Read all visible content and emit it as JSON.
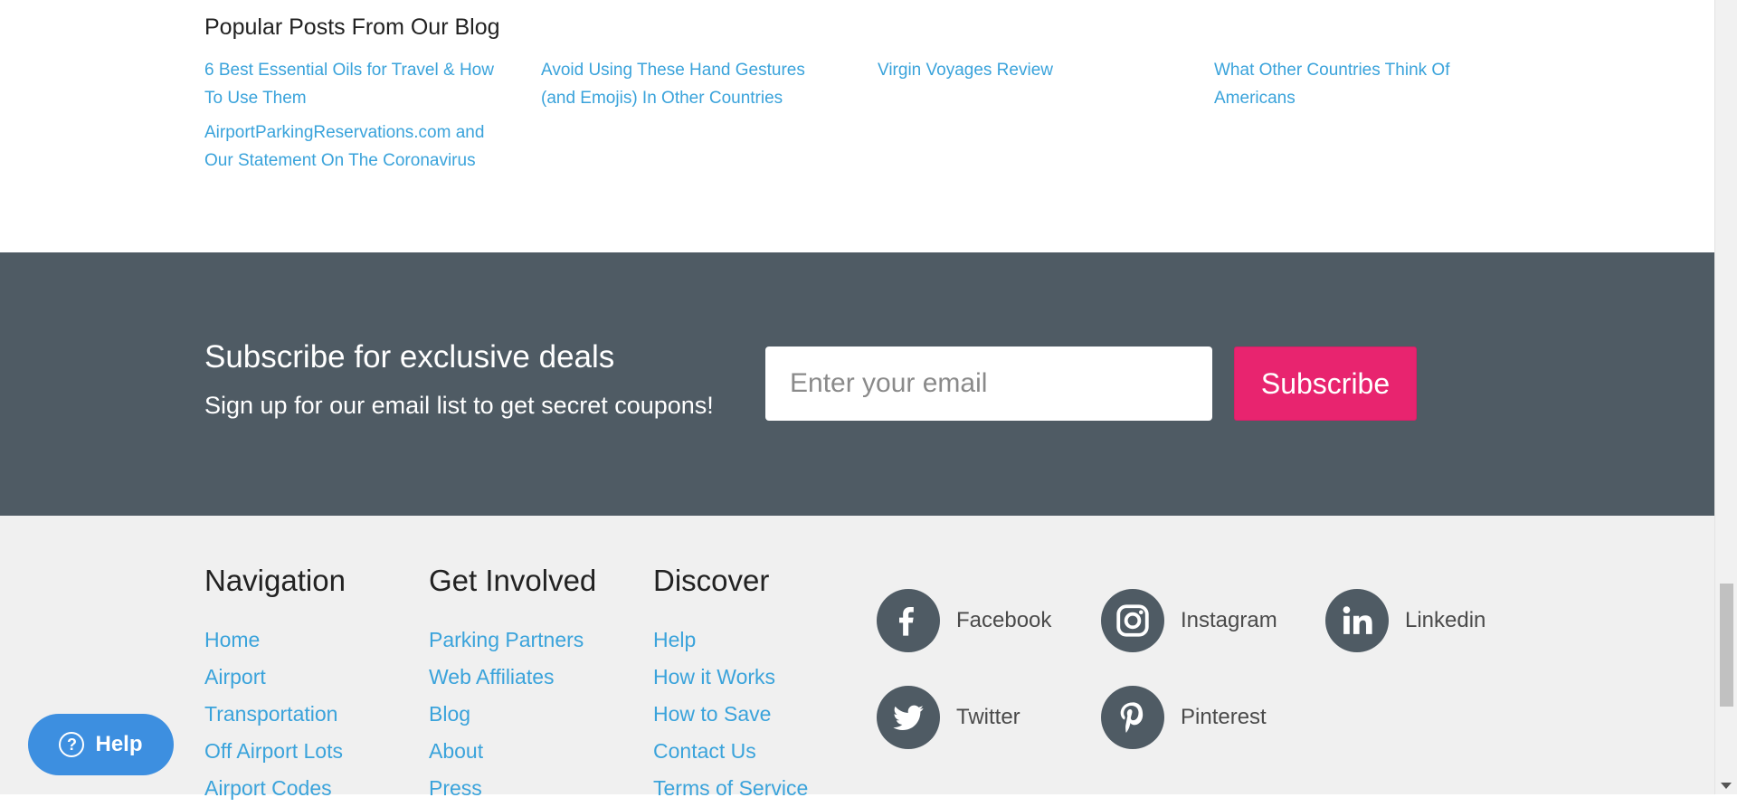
{
  "blog": {
    "title": "Popular Posts From Our Blog",
    "posts": [
      "6 Best Essential Oils for Travel & How To Use Them",
      "Avoid Using These Hand Gestures (and Emojis) In Other Countries",
      "Virgin Voyages Review",
      "What Other Countries Think Of Americans",
      "AirportParkingReservations.com and Our Statement On The Coronavirus"
    ]
  },
  "subscribe": {
    "heading": "Subscribe for exclusive deals",
    "text": "Sign up for our email list to get secret coupons!",
    "email_placeholder": "Enter your email",
    "button_label": "Subscribe"
  },
  "footer": {
    "navigation": {
      "heading": "Navigation",
      "items": [
        "Home",
        "Airport",
        "Transportation",
        "Off Airport Lots",
        "Airport Codes"
      ]
    },
    "get_involved": {
      "heading": "Get Involved",
      "items": [
        "Parking Partners",
        "Web Affiliates",
        "Blog",
        "About",
        "Press"
      ]
    },
    "discover": {
      "heading": "Discover",
      "items": [
        "Help",
        "How it Works",
        "How to Save",
        "Contact Us",
        "Terms of Service"
      ]
    },
    "social": [
      {
        "label": "Facebook",
        "icon": "facebook-icon"
      },
      {
        "label": "Instagram",
        "icon": "instagram-icon"
      },
      {
        "label": "Linkedin",
        "icon": "linkedin-icon"
      },
      {
        "label": "Twitter",
        "icon": "twitter-icon"
      },
      {
        "label": "Pinterest",
        "icon": "pinterest-icon"
      }
    ]
  },
  "help_widget": {
    "label": "Help",
    "icon_glyph": "?"
  },
  "colors": {
    "link": "#3aa3db",
    "subscribe_band": "#4f5b64",
    "subscribe_button": "#e8246f",
    "footer_bg": "#f0f0f0",
    "help_button": "#3d8fe0"
  }
}
